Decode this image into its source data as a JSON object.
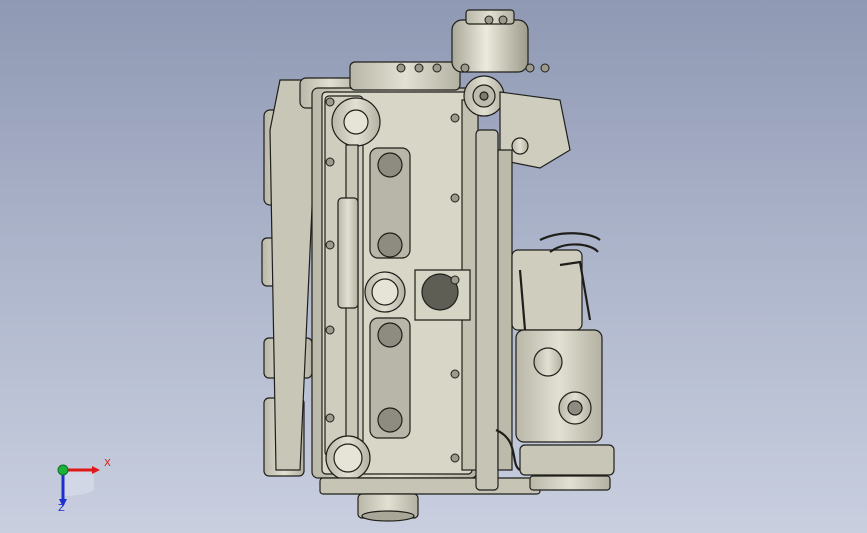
{
  "viewport": {
    "background_top": "#8f99b3",
    "background_bottom": "#c9cfdf",
    "model": "engine-assembly-cad-model"
  },
  "model_colors": {
    "metal": "#d4d2c2",
    "metal_dark": "#a9a798",
    "edge": "#1f1f1a"
  },
  "triad": {
    "x_label": "X",
    "z_label": "Z",
    "x_color": "#e01818",
    "y_color": "#19b33a",
    "z_color": "#1c2fd0"
  }
}
